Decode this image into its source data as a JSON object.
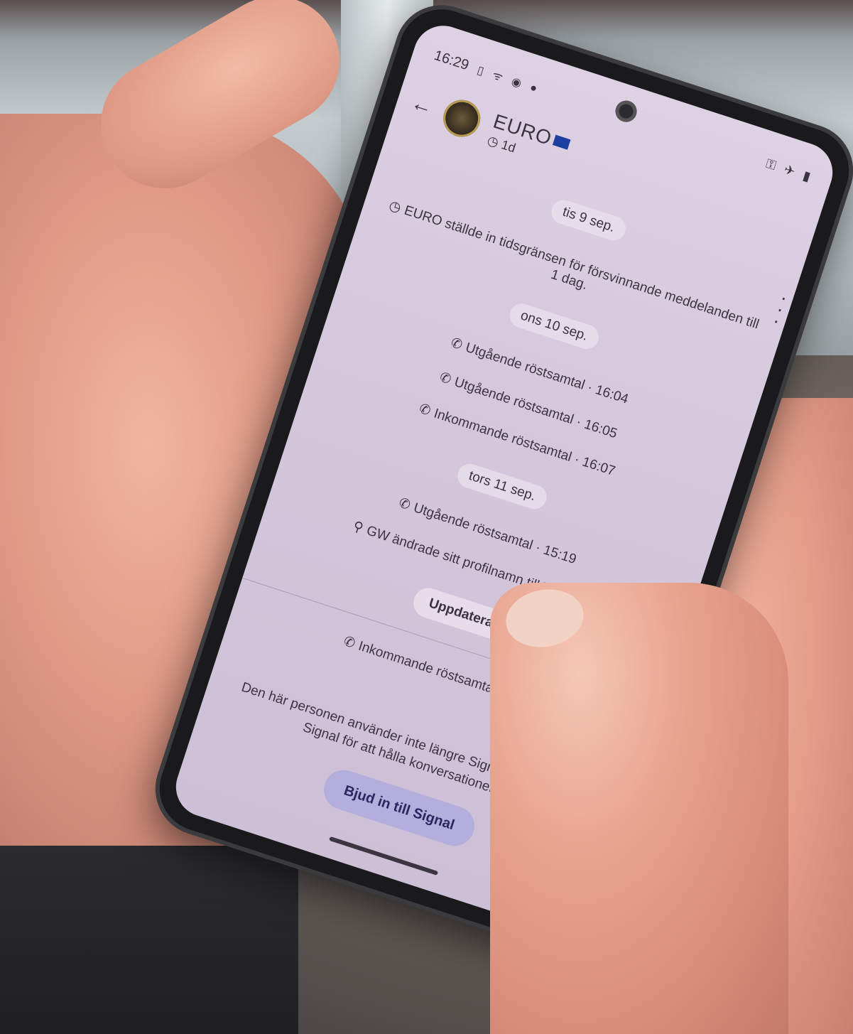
{
  "status_bar": {
    "time": "16:29"
  },
  "header": {
    "contact_name": "EURO",
    "timer_label": "1d"
  },
  "feed": {
    "system_notice": "EURO ställde in tidsgränsen för försvinnande meddelanden till 1 dag.",
    "days": [
      {
        "date": "tis 9 sep."
      },
      {
        "date": "ons 10 sep."
      },
      {
        "date": "tors 11 sep."
      }
    ],
    "events": [
      {
        "text": "Utgående röstsamtal · 16:04"
      },
      {
        "text": "Utgående röstsamtal · 16:05"
      },
      {
        "text": "Inkommande röstsamtal · 16:07"
      },
      {
        "text": "Utgående röstsamtal · 15:19"
      },
      {
        "text": "GW ändrade sitt profilnamn till THANOS."
      },
      {
        "text": "Inkommande röstsamtal · 22:12"
      }
    ],
    "update_button": "Uppdatera"
  },
  "footer": {
    "note": "Den här personen använder inte längre Signal. Bjud in dem till Signal för att hålla konversationen här.",
    "invite_button": "Bjud in till Signal"
  },
  "colors": {
    "screen_bg": "#d5c8dc",
    "invite_button_bg": "#b4aedc",
    "eu_flag": "#1d3fa0"
  },
  "icons": {
    "back": "arrow-left",
    "timer": "clock-icon",
    "call": "phone-icon",
    "profile": "person-icon",
    "more": "vertical-dots-icon"
  }
}
